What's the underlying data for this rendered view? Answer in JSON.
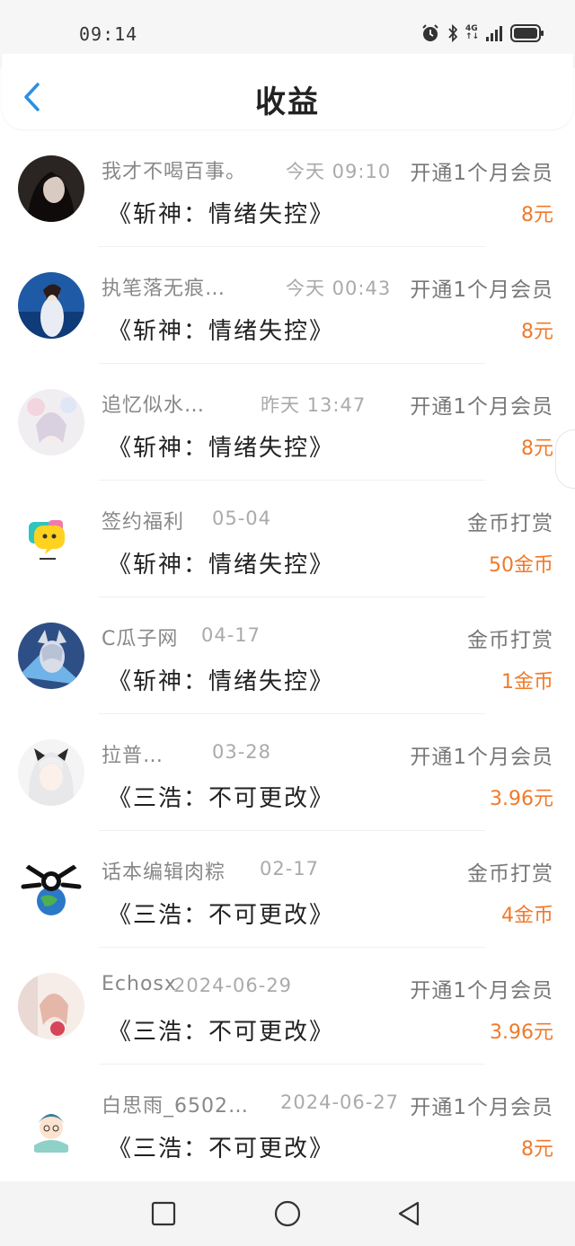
{
  "status_bar": {
    "time": "09:14",
    "icons": [
      "alarm-icon",
      "bluetooth-icon",
      "mobile-data-icon",
      "signal-icon",
      "battery-icon"
    ],
    "network_label": "4G"
  },
  "header": {
    "title": "收益",
    "back_icon": "chevron-left-icon",
    "accent_color": "#2b8fe3"
  },
  "colors": {
    "amount": "#f07a2a",
    "name": "#888888",
    "type": "#777777"
  },
  "items": [
    {
      "name": "我才不喝百事。",
      "time": "今天 09:10",
      "type": "开通1个月会员",
      "book": "《斩神：情绪失控》",
      "amount": "8元"
    },
    {
      "name": "执笔落无痕…",
      "time": "今天 00:43",
      "type": "开通1个月会员",
      "book": "《斩神：情绪失控》",
      "amount": "8元"
    },
    {
      "name": "追忆似水…",
      "time": "昨天 13:47",
      "type": "开通1个月会员",
      "book": "《斩神：情绪失控》",
      "amount": "8元"
    },
    {
      "name": "签约福利",
      "time": "05-04",
      "type": "金币打赏",
      "book": "《斩神：情绪失控》",
      "amount": "50金币"
    },
    {
      "name": "C瓜子网",
      "time": "04-17",
      "type": "金币打赏",
      "book": "《斩神：情绪失控》",
      "amount": "1金币"
    },
    {
      "name": "拉普…",
      "time": "03-28",
      "type": "开通1个月会员",
      "book": "《三浩：不可更改》",
      "amount": "3.96元"
    },
    {
      "name": "话本编辑肉粽",
      "time": "02-17",
      "type": "金币打赏",
      "book": "《三浩：不可更改》",
      "amount": "4金币"
    },
    {
      "name": "Echosx",
      "time": "2024-06-29",
      "type": "开通1个月会员",
      "book": "《三浩：不可更改》",
      "amount": "3.96元"
    },
    {
      "name": "白思雨_6502…",
      "time": "2024-06-27",
      "type": "开通1个月会员",
      "book": "《三浩：不可更改》",
      "amount": "8元"
    }
  ],
  "nav_bar": {
    "buttons": [
      "recents-square-icon",
      "home-circle-icon",
      "back-triangle-icon"
    ]
  }
}
